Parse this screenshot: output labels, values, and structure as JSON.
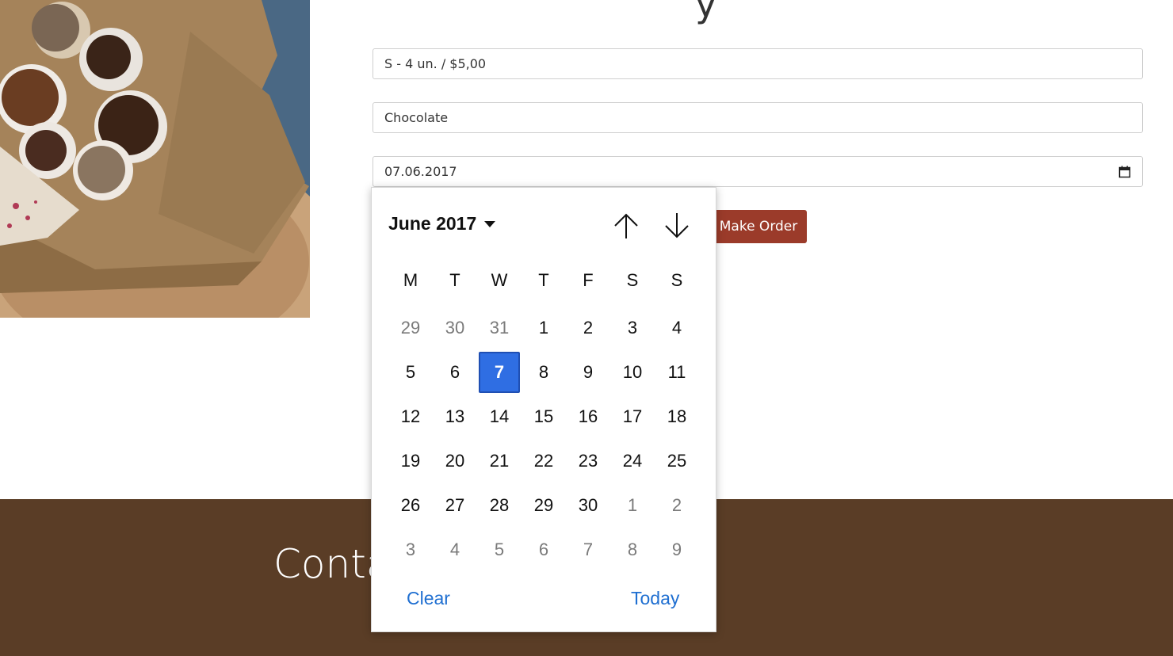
{
  "heading_fragment": "y",
  "form": {
    "size_select": "S - 4 un. / $5,00",
    "flavor_select": "Chocolate",
    "date_input": "07.06.2017",
    "submit_label": "Make Order"
  },
  "footer": {
    "title": "Conta"
  },
  "datepicker": {
    "month_label": "June 2017",
    "weekdays": [
      "M",
      "T",
      "W",
      "T",
      "F",
      "S",
      "S"
    ],
    "days": [
      {
        "d": "29",
        "other": true
      },
      {
        "d": "30",
        "other": true
      },
      {
        "d": "31",
        "other": true
      },
      {
        "d": "1"
      },
      {
        "d": "2"
      },
      {
        "d": "3"
      },
      {
        "d": "4"
      },
      {
        "d": "5"
      },
      {
        "d": "6"
      },
      {
        "d": "7",
        "selected": true
      },
      {
        "d": "8"
      },
      {
        "d": "9"
      },
      {
        "d": "10"
      },
      {
        "d": "11"
      },
      {
        "d": "12"
      },
      {
        "d": "13"
      },
      {
        "d": "14"
      },
      {
        "d": "15"
      },
      {
        "d": "16"
      },
      {
        "d": "17"
      },
      {
        "d": "18"
      },
      {
        "d": "19"
      },
      {
        "d": "20"
      },
      {
        "d": "21"
      },
      {
        "d": "22"
      },
      {
        "d": "23"
      },
      {
        "d": "24"
      },
      {
        "d": "25"
      },
      {
        "d": "26"
      },
      {
        "d": "27"
      },
      {
        "d": "28"
      },
      {
        "d": "29"
      },
      {
        "d": "30"
      },
      {
        "d": "1",
        "other": true
      },
      {
        "d": "2",
        "other": true
      },
      {
        "d": "3",
        "other": true
      },
      {
        "d": "4",
        "other": true
      },
      {
        "d": "5",
        "other": true
      },
      {
        "d": "6",
        "other": true
      },
      {
        "d": "7",
        "other": true
      },
      {
        "d": "8",
        "other": true
      },
      {
        "d": "9",
        "other": true
      }
    ],
    "clear_label": "Clear",
    "today_label": "Today"
  },
  "icons": {
    "calendar": "calendar-icon",
    "up": "arrow-up-icon",
    "down": "arrow-down-icon",
    "caret": "caret-down-icon"
  },
  "colors": {
    "accent_button": "#9b3b2a",
    "footer_bg": "#5a3d26",
    "selected_day": "#2f6ee3",
    "link": "#1f6fd1"
  }
}
